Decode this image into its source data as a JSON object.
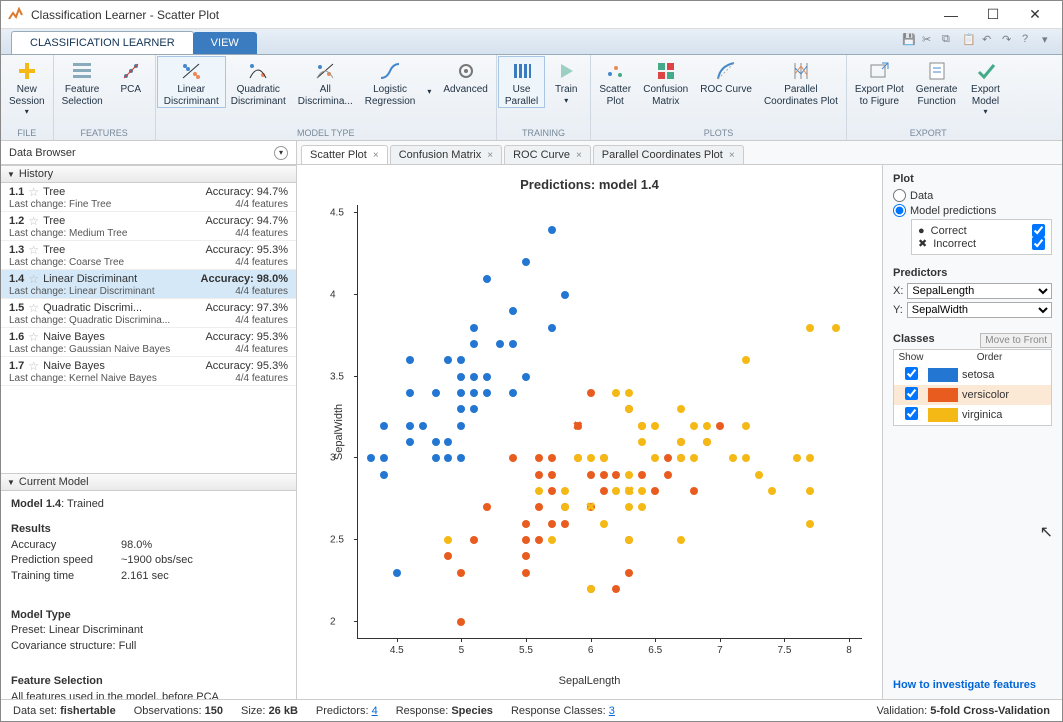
{
  "window_title": "Classification Learner - Scatter Plot",
  "tabs": {
    "t1": "CLASSIFICATION LEARNER",
    "t2": "VIEW"
  },
  "ribbon_groups": {
    "file": "FILE",
    "features": "FEATURES",
    "modeltype": "MODEL TYPE",
    "training": "TRAINING",
    "plots": "PLOTS",
    "export": "EXPORT"
  },
  "ribbon": {
    "new_session": "New\nSession",
    "feature_selection": "Feature\nSelection",
    "pca": "PCA",
    "linear_disc": "Linear\nDiscriminant",
    "quadratic_disc": "Quadratic\nDiscriminant",
    "all_disc": "All\nDiscrimina...",
    "logistic": "Logistic\nRegression",
    "advanced": "Advanced",
    "use_parallel": "Use\nParallel",
    "train": "Train",
    "scatter": "Scatter\nPlot",
    "confusion": "Confusion\nMatrix",
    "roc": "ROC Curve",
    "parcoord": "Parallel\nCoordinates Plot",
    "export_fig": "Export Plot\nto Figure",
    "genfunc": "Generate\nFunction",
    "export_model": "Export\nModel"
  },
  "data_browser_label": "Data Browser",
  "history_label": "History",
  "doctabs": {
    "scatter": "Scatter Plot",
    "confusion": "Confusion Matrix",
    "roc": "ROC Curve",
    "parcoord": "Parallel Coordinates Plot"
  },
  "history": [
    {
      "idx": "1.1",
      "name": "Tree",
      "acc": "Accuracy:  94.7%",
      "lc": "Last change:  Fine Tree",
      "feat": "4/4 features"
    },
    {
      "idx": "1.2",
      "name": "Tree",
      "acc": "Accuracy:  94.7%",
      "lc": "Last change:  Medium Tree",
      "feat": "4/4 features"
    },
    {
      "idx": "1.3",
      "name": "Tree",
      "acc": "Accuracy:  95.3%",
      "lc": "Last change:  Coarse Tree",
      "feat": "4/4 features"
    },
    {
      "idx": "1.4",
      "name": "Linear Discriminant",
      "acc": "Accuracy:  98.0%",
      "lc": "Last change:  Linear Discriminant",
      "feat": "4/4 features"
    },
    {
      "idx": "1.5",
      "name": "Quadratic Discrimi...",
      "acc": "Accuracy:  97.3%",
      "lc": "Last change:  Quadratic Discrimina...",
      "feat": "4/4 features"
    },
    {
      "idx": "1.6",
      "name": "Naive Bayes",
      "acc": "Accuracy:  95.3%",
      "lc": "Last change:  Gaussian Naive Bayes",
      "feat": "4/4 features"
    },
    {
      "idx": "1.7",
      "name": "Naive Bayes",
      "acc": "Accuracy:  95.3%",
      "lc": "Last change:  Kernel Naive Bayes",
      "feat": "4/4 features"
    }
  ],
  "current_model_label": "Current Model",
  "curmodel": {
    "title_label": "Model 1.4",
    "title_status": ": Trained",
    "results_h": "Results",
    "acc_l": "Accuracy",
    "acc_v": "98.0%",
    "speed_l": "Prediction speed",
    "speed_v": "~1900 obs/sec",
    "time_l": "Training time",
    "time_v": "2.161 sec",
    "mtype_h": "Model Type",
    "preset": "Preset: Linear Discriminant",
    "cov": "Covariance structure: Full",
    "fsel_h": "Feature Selection",
    "fsel_t": "All features used in the model, before PCA"
  },
  "rpanel": {
    "plot_h": "Plot",
    "data_opt": "Data",
    "pred_opt": "Model predictions",
    "correct": "Correct",
    "incorrect": "Incorrect",
    "pred_h": "Predictors",
    "x_l": "X:",
    "y_l": "Y:",
    "x_v": "SepalLength",
    "y_v": "SepalWidth",
    "classes_h": "Classes",
    "move": "Move to Front",
    "show_h": "Show",
    "order_h": "Order",
    "c0": "setosa",
    "c1": "versicolor",
    "c2": "virginica",
    "link": "How to investigate features"
  },
  "status": {
    "dataset_l": "Data set:",
    "dataset_v": "fishertable",
    "obs_l": "Observations:",
    "obs_v": "150",
    "size_l": "Size:",
    "size_v": "26 kB",
    "pred_l": "Predictors:",
    "pred_v": "4",
    "resp_l": "Response:",
    "resp_v": "Species",
    "rc_l": "Response Classes:",
    "rc_v": "3",
    "val_l": "Validation:",
    "val_v": "5-fold Cross-Validation"
  },
  "chart_data": {
    "type": "scatter",
    "title": "Predictions: model 1.4",
    "xlabel": "SepalLength",
    "ylabel": "SepalWidth",
    "xlim": [
      4.2,
      8.1
    ],
    "ylim": [
      1.9,
      4.55
    ],
    "xticks": [
      4.5,
      5,
      5.5,
      6,
      6.5,
      7,
      7.5,
      8
    ],
    "yticks": [
      2,
      2.5,
      3,
      3.5,
      4,
      4.5
    ],
    "series": [
      {
        "name": "setosa",
        "color": "#2376d1",
        "points": [
          [
            4.3,
            3.0
          ],
          [
            4.4,
            2.9
          ],
          [
            4.4,
            3.0
          ],
          [
            4.4,
            3.2
          ],
          [
            4.5,
            2.3
          ],
          [
            4.6,
            3.1
          ],
          [
            4.6,
            3.2
          ],
          [
            4.6,
            3.4
          ],
          [
            4.6,
            3.6
          ],
          [
            4.7,
            3.2
          ],
          [
            4.8,
            3.0
          ],
          [
            4.8,
            3.1
          ],
          [
            4.8,
            3.4
          ],
          [
            4.9,
            3.0
          ],
          [
            4.9,
            3.1
          ],
          [
            4.9,
            3.6
          ],
          [
            5.0,
            3.0
          ],
          [
            5.0,
            3.2
          ],
          [
            5.0,
            3.3
          ],
          [
            5.0,
            3.4
          ],
          [
            5.0,
            3.5
          ],
          [
            5.0,
            3.6
          ],
          [
            5.1,
            3.3
          ],
          [
            5.1,
            3.4
          ],
          [
            5.1,
            3.5
          ],
          [
            5.1,
            3.7
          ],
          [
            5.1,
            3.8
          ],
          [
            5.2,
            3.4
          ],
          [
            5.2,
            3.5
          ],
          [
            5.2,
            4.1
          ],
          [
            5.3,
            3.7
          ],
          [
            5.4,
            3.4
          ],
          [
            5.4,
            3.7
          ],
          [
            5.4,
            3.9
          ],
          [
            5.5,
            3.5
          ],
          [
            5.5,
            4.2
          ],
          [
            5.7,
            3.8
          ],
          [
            5.7,
            4.4
          ],
          [
            5.8,
            4.0
          ]
        ]
      },
      {
        "name": "versicolor",
        "color": "#e85d1f",
        "points": [
          [
            4.9,
            2.4
          ],
          [
            5.0,
            2.0
          ],
          [
            5.0,
            2.3
          ],
          [
            5.1,
            2.5
          ],
          [
            5.2,
            2.7
          ],
          [
            5.4,
            3.0
          ],
          [
            5.5,
            2.3
          ],
          [
            5.5,
            2.4
          ],
          [
            5.5,
            2.5
          ],
          [
            5.5,
            2.6
          ],
          [
            5.6,
            2.5
          ],
          [
            5.6,
            2.7
          ],
          [
            5.6,
            2.9
          ],
          [
            5.6,
            3.0
          ],
          [
            5.7,
            2.6
          ],
          [
            5.7,
            2.8
          ],
          [
            5.7,
            2.9
          ],
          [
            5.7,
            3.0
          ],
          [
            5.8,
            2.6
          ],
          [
            5.8,
            2.7
          ],
          [
            5.9,
            3.0
          ],
          [
            5.9,
            3.2
          ],
          [
            6.0,
            2.2
          ],
          [
            6.0,
            2.7
          ],
          [
            6.0,
            2.9
          ],
          [
            6.0,
            3.4
          ],
          [
            6.1,
            2.8
          ],
          [
            6.1,
            2.9
          ],
          [
            6.1,
            3.0
          ],
          [
            6.2,
            2.2
          ],
          [
            6.2,
            2.9
          ],
          [
            6.3,
            2.3
          ],
          [
            6.3,
            2.5
          ],
          [
            6.3,
            3.3
          ],
          [
            6.4,
            2.9
          ],
          [
            6.4,
            3.2
          ],
          [
            6.5,
            2.8
          ],
          [
            6.6,
            2.9
          ],
          [
            6.6,
            3.0
          ],
          [
            6.7,
            3.0
          ],
          [
            6.7,
            3.1
          ],
          [
            6.8,
            2.8
          ],
          [
            6.9,
            3.1
          ],
          [
            7.0,
            3.2
          ]
        ]
      },
      {
        "name": "virginica",
        "color": "#f5b915",
        "points": [
          [
            4.9,
            2.5
          ],
          [
            5.6,
            2.8
          ],
          [
            5.7,
            2.5
          ],
          [
            5.8,
            2.7
          ],
          [
            5.8,
            2.8
          ],
          [
            5.9,
            3.0
          ],
          [
            6.0,
            2.2
          ],
          [
            6.0,
            3.0
          ],
          [
            6.1,
            2.6
          ],
          [
            6.1,
            3.0
          ],
          [
            6.2,
            2.8
          ],
          [
            6.2,
            3.4
          ],
          [
            6.3,
            2.5
          ],
          [
            6.3,
            2.7
          ],
          [
            6.3,
            2.8
          ],
          [
            6.3,
            2.9
          ],
          [
            6.3,
            3.3
          ],
          [
            6.3,
            3.4
          ],
          [
            6.4,
            2.7
          ],
          [
            6.4,
            2.8
          ],
          [
            6.4,
            3.1
          ],
          [
            6.4,
            3.2
          ],
          [
            6.5,
            3.0
          ],
          [
            6.5,
            3.2
          ],
          [
            6.7,
            2.5
          ],
          [
            6.7,
            3.0
          ],
          [
            6.7,
            3.1
          ],
          [
            6.7,
            3.3
          ],
          [
            6.8,
            3.0
          ],
          [
            6.8,
            3.2
          ],
          [
            6.9,
            3.1
          ],
          [
            6.9,
            3.2
          ],
          [
            7.1,
            3.0
          ],
          [
            7.2,
            3.0
          ],
          [
            7.2,
            3.2
          ],
          [
            7.2,
            3.6
          ],
          [
            7.3,
            2.9
          ],
          [
            7.4,
            2.8
          ],
          [
            7.6,
            3.0
          ],
          [
            7.7,
            2.6
          ],
          [
            7.7,
            2.8
          ],
          [
            7.7,
            3.0
          ],
          [
            7.7,
            3.8
          ],
          [
            7.9,
            3.8
          ]
        ]
      }
    ],
    "incorrect": [
      [
        5.9,
        3.2,
        "#e85d1f"
      ],
      [
        6.0,
        2.7,
        "#f5b915"
      ],
      [
        6.3,
        2.8,
        "#f5b915"
      ]
    ]
  }
}
